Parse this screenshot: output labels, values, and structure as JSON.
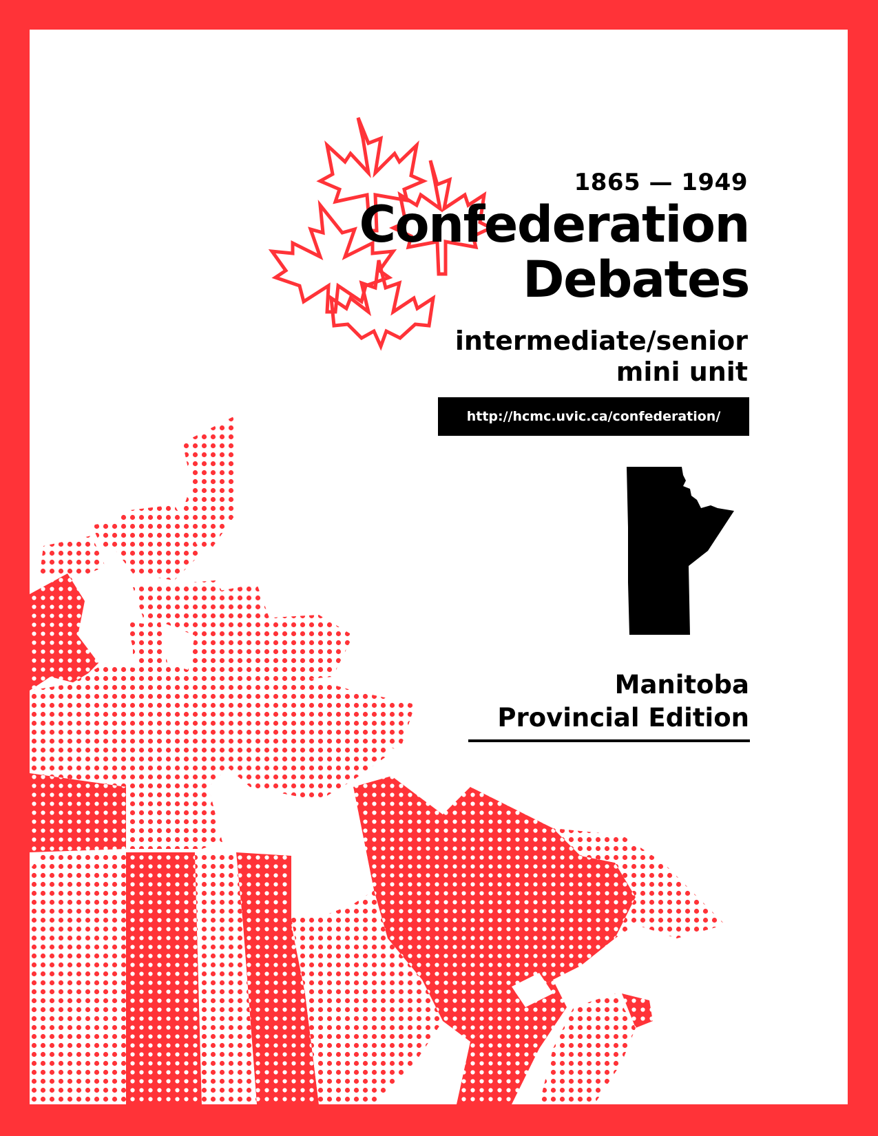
{
  "colors": {
    "accent": "#ff3338",
    "ink": "#000000",
    "paper": "#ffffff"
  },
  "cover": {
    "years": "1865 — 1949",
    "title_line1": "Confederation",
    "title_line2": "Debates",
    "subtitle_line1": "intermediate/senior",
    "subtitle_line2": "mini unit",
    "url": "http://hcmc.uvic.ca/confederation/",
    "edition_line1": "Manitoba",
    "edition_line2": "Provincial Edition"
  },
  "icons": {
    "logo": "maple-leaves-outline-icon",
    "province": "manitoba-silhouette-icon",
    "background": "canada-halftone-map"
  }
}
